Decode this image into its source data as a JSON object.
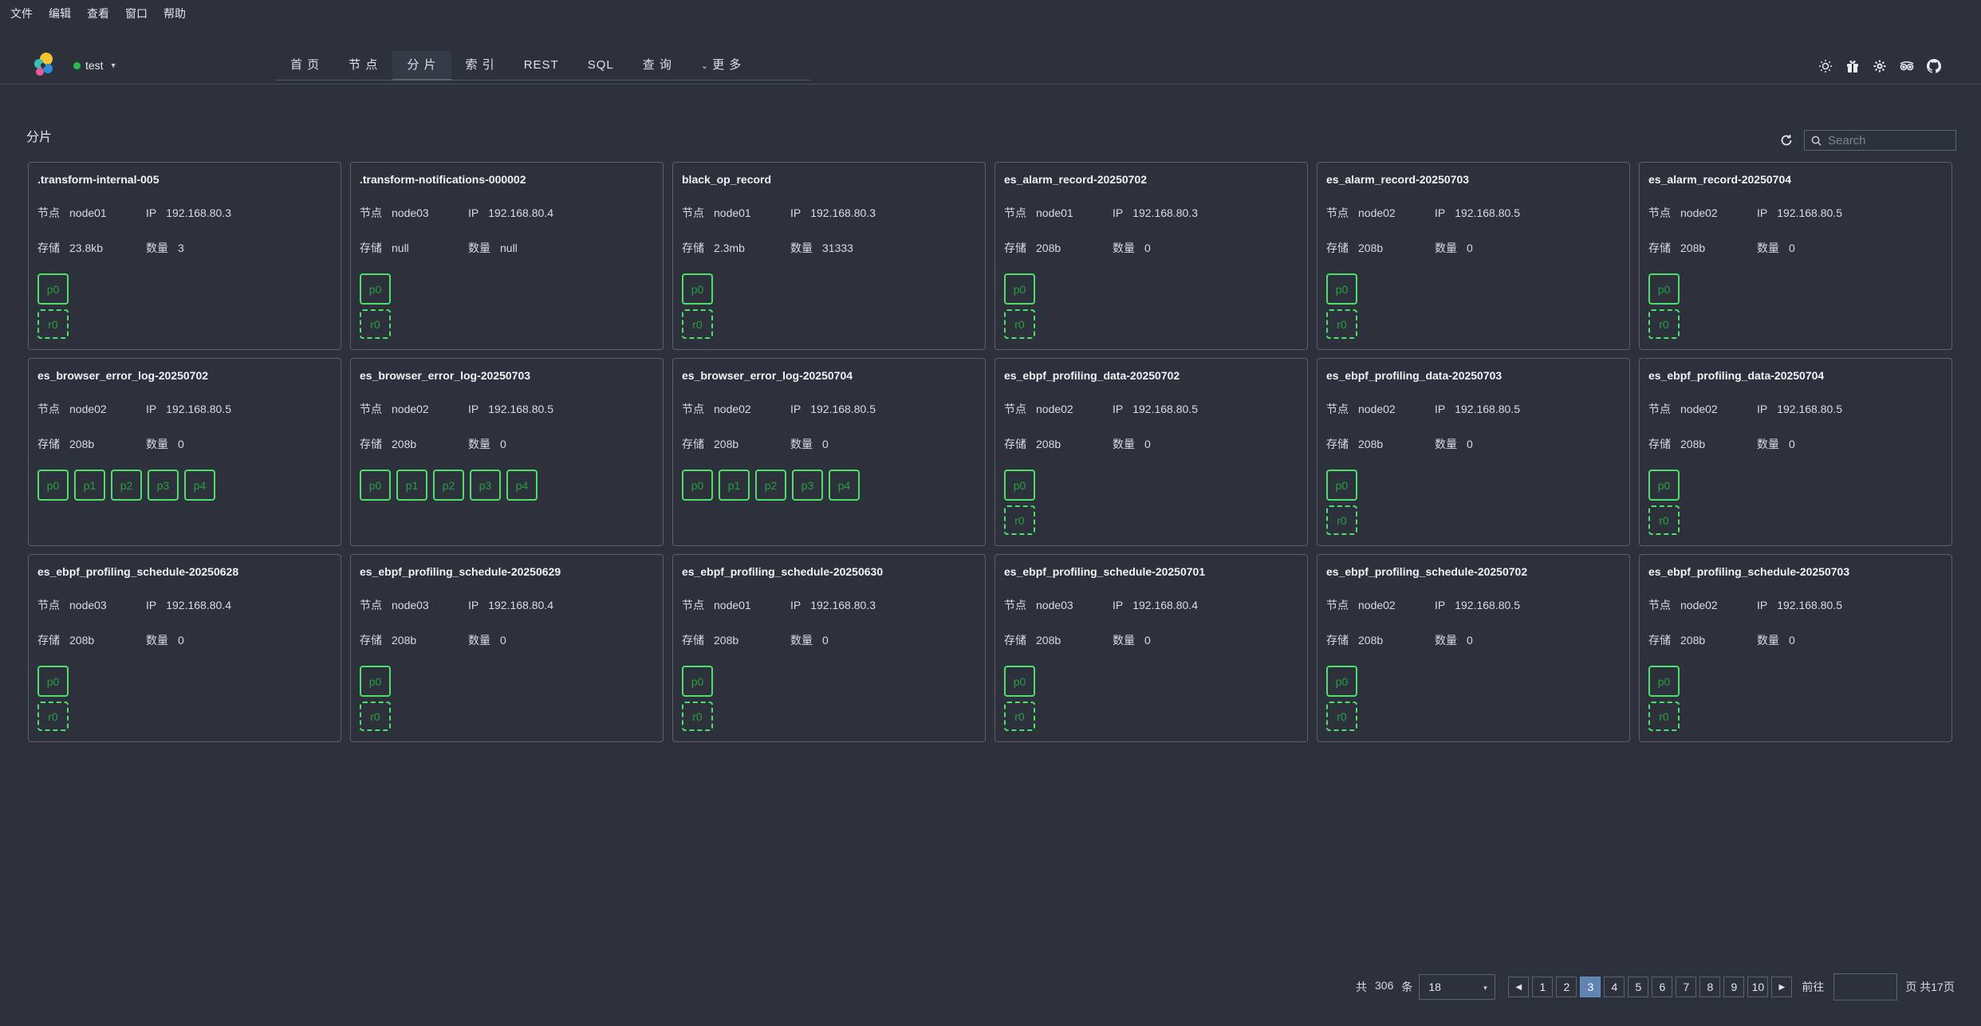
{
  "menubar": [
    "文件",
    "编辑",
    "查看",
    "窗口",
    "帮助"
  ],
  "header": {
    "cluster_name": "test",
    "nav": [
      {
        "label": "首 页",
        "active": false
      },
      {
        "label": "节 点",
        "active": false
      },
      {
        "label": "分 片",
        "active": true
      },
      {
        "label": "索 引",
        "active": false
      },
      {
        "label": "REST",
        "active": false
      },
      {
        "label": "SQL",
        "active": false
      },
      {
        "label": "查 询",
        "active": false
      },
      {
        "label": "更 多",
        "active": false
      }
    ],
    "icons": [
      "sun-icon",
      "gift-icon",
      "settings-icon",
      "tripadvisor-icon",
      "github-icon"
    ]
  },
  "panel": {
    "title": "分片",
    "search_placeholder": "Search"
  },
  "labels": {
    "node": "节点",
    "ip": "IP",
    "store": "存储",
    "count": "数量"
  },
  "cards": [
    {
      "title": ".transform-internal-005",
      "node": "node01",
      "ip": "192.168.80.3",
      "store": "23.8kb",
      "count": "3",
      "primaries": [
        "p0"
      ],
      "replicas": [
        "r0"
      ]
    },
    {
      "title": ".transform-notifications-000002",
      "node": "node03",
      "ip": "192.168.80.4",
      "store": "null",
      "count": "null",
      "primaries": [
        "p0"
      ],
      "replicas": [
        "r0"
      ]
    },
    {
      "title": "black_op_record",
      "node": "node01",
      "ip": "192.168.80.3",
      "store": "2.3mb",
      "count": "31333",
      "primaries": [
        "p0"
      ],
      "replicas": [
        "r0"
      ]
    },
    {
      "title": "es_alarm_record-20250702",
      "node": "node01",
      "ip": "192.168.80.3",
      "store": "208b",
      "count": "0",
      "primaries": [
        "p0"
      ],
      "replicas": [
        "r0"
      ]
    },
    {
      "title": "es_alarm_record-20250703",
      "node": "node02",
      "ip": "192.168.80.5",
      "store": "208b",
      "count": "0",
      "primaries": [
        "p0"
      ],
      "replicas": [
        "r0"
      ]
    },
    {
      "title": "es_alarm_record-20250704",
      "node": "node02",
      "ip": "192.168.80.5",
      "store": "208b",
      "count": "0",
      "primaries": [
        "p0"
      ],
      "replicas": [
        "r0"
      ]
    },
    {
      "title": "es_browser_error_log-20250702",
      "node": "node02",
      "ip": "192.168.80.5",
      "store": "208b",
      "count": "0",
      "primaries": [
        "p0",
        "p1",
        "p2",
        "p3",
        "p4"
      ],
      "replicas": []
    },
    {
      "title": "es_browser_error_log-20250703",
      "node": "node02",
      "ip": "192.168.80.5",
      "store": "208b",
      "count": "0",
      "primaries": [
        "p0",
        "p1",
        "p2",
        "p3",
        "p4"
      ],
      "replicas": []
    },
    {
      "title": "es_browser_error_log-20250704",
      "node": "node02",
      "ip": "192.168.80.5",
      "store": "208b",
      "count": "0",
      "primaries": [
        "p0",
        "p1",
        "p2",
        "p3",
        "p4"
      ],
      "replicas": []
    },
    {
      "title": "es_ebpf_profiling_data-20250702",
      "node": "node02",
      "ip": "192.168.80.5",
      "store": "208b",
      "count": "0",
      "primaries": [
        "p0"
      ],
      "replicas": [
        "r0"
      ]
    },
    {
      "title": "es_ebpf_profiling_data-20250703",
      "node": "node02",
      "ip": "192.168.80.5",
      "store": "208b",
      "count": "0",
      "primaries": [
        "p0"
      ],
      "replicas": [
        "r0"
      ]
    },
    {
      "title": "es_ebpf_profiling_data-20250704",
      "node": "node02",
      "ip": "192.168.80.5",
      "store": "208b",
      "count": "0",
      "primaries": [
        "p0"
      ],
      "replicas": [
        "r0"
      ]
    },
    {
      "title": "es_ebpf_profiling_schedule-20250628",
      "node": "node03",
      "ip": "192.168.80.4",
      "store": "208b",
      "count": "0",
      "primaries": [
        "p0"
      ],
      "replicas": [
        "r0"
      ]
    },
    {
      "title": "es_ebpf_profiling_schedule-20250629",
      "node": "node03",
      "ip": "192.168.80.4",
      "store": "208b",
      "count": "0",
      "primaries": [
        "p0"
      ],
      "replicas": [
        "r0"
      ]
    },
    {
      "title": "es_ebpf_profiling_schedule-20250630",
      "node": "node01",
      "ip": "192.168.80.3",
      "store": "208b",
      "count": "0",
      "primaries": [
        "p0"
      ],
      "replicas": [
        "r0"
      ]
    },
    {
      "title": "es_ebpf_profiling_schedule-20250701",
      "node": "node03",
      "ip": "192.168.80.4",
      "store": "208b",
      "count": "0",
      "primaries": [
        "p0"
      ],
      "replicas": [
        "r0"
      ]
    },
    {
      "title": "es_ebpf_profiling_schedule-20250702",
      "node": "node02",
      "ip": "192.168.80.5",
      "store": "208b",
      "count": "0",
      "primaries": [
        "p0"
      ],
      "replicas": [
        "r0"
      ]
    },
    {
      "title": "es_ebpf_profiling_schedule-20250703",
      "node": "node02",
      "ip": "192.168.80.5",
      "store": "208b",
      "count": "0",
      "primaries": [
        "p0"
      ],
      "replicas": [
        "r0"
      ]
    }
  ],
  "pagination": {
    "total_prefix": "共",
    "total": "306",
    "total_suffix": "条",
    "page_size": "18",
    "pages": [
      "1",
      "2",
      "3",
      "4",
      "5",
      "6",
      "7",
      "8",
      "9",
      "10"
    ],
    "current": "3",
    "goto_label": "前往",
    "page_suffix": "页 共17页"
  },
  "colors": {
    "background": "#2c313c",
    "shard_border": "#4ee06a",
    "shard_text": "#2a9f40",
    "active_page": "#5f83b3",
    "status_dot": "#2dbb4e"
  }
}
